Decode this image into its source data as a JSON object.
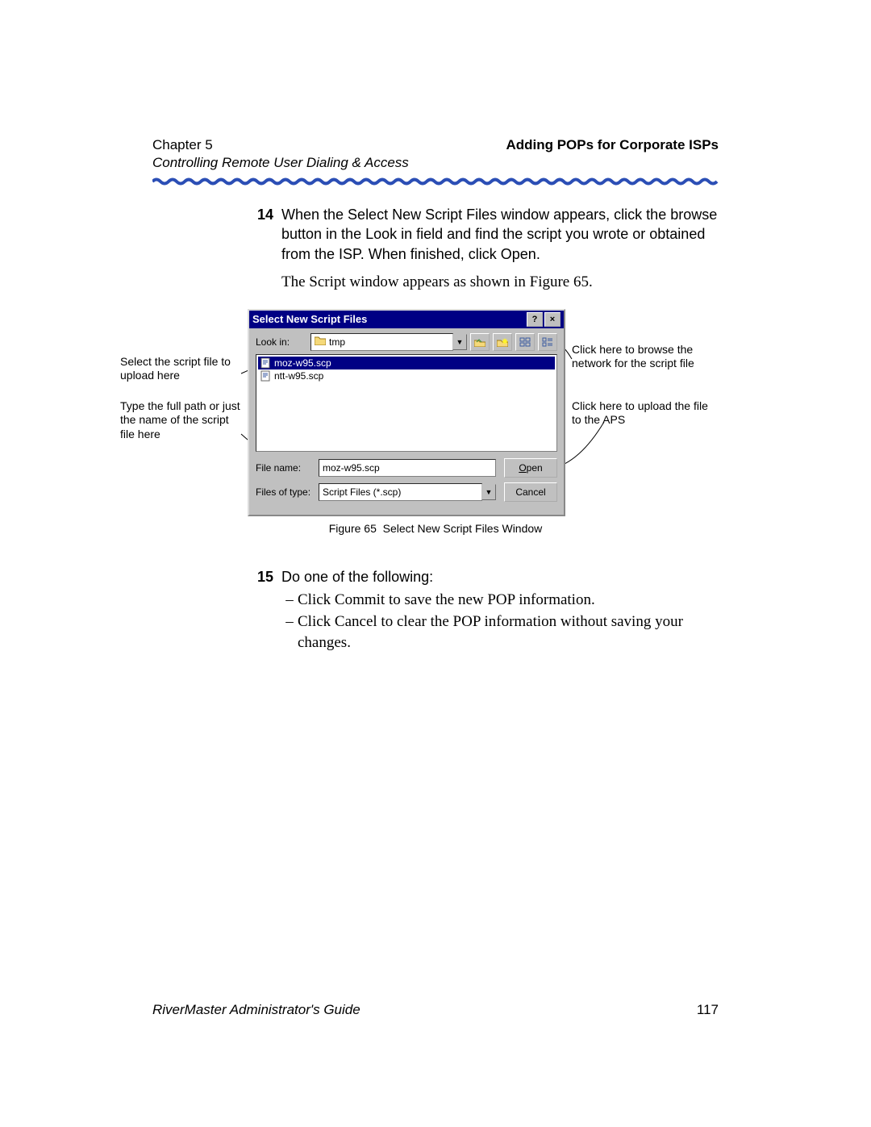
{
  "header": {
    "chapter": "Chapter 5",
    "right": "Adding POPs for Corporate ISPs",
    "sub": "Controlling Remote User Dialing & Access"
  },
  "step14": {
    "num": "14",
    "sentence1": "When the Select New Script Files window appears, click the browse button in the Look in field and find the script you wrote or obtained from the ISP. When finished, click Open.",
    "sentence2": "The Script window appears as shown in Figure 65."
  },
  "dialog": {
    "title": "Select New Script Files",
    "help_btn": "?",
    "close_btn": "×",
    "lookin_label": "Look in:",
    "lookin_value": "tmp",
    "files": [
      {
        "name": "moz-w95.scp",
        "selected": true
      },
      {
        "name": "ntt-w95.scp",
        "selected": false
      }
    ],
    "filename_label": "File name:",
    "filename_value": "moz-w95.scp",
    "filetype_label": "Files of type:",
    "filetype_value": "Script Files (*.scp)",
    "open_btn": "Open",
    "cancel_btn": "Cancel"
  },
  "callouts": {
    "left1": "Select the script file to upload here",
    "left2": "Type the full path or just the name of the script file here",
    "right1": "Click here to browse the network for the script file",
    "right2": "Click here to upload the file to the APS"
  },
  "figure": {
    "label": "Figure 65",
    "text": "Select New Script Files Window"
  },
  "step15": {
    "num": "15",
    "intro": "Do one of the following:",
    "b1": "Click Commit to save the new POP information.",
    "b2": "Click Cancel to clear the POP information without saving your changes."
  },
  "footer": {
    "left": "RiverMaster Administrator's Guide",
    "page": "117"
  }
}
